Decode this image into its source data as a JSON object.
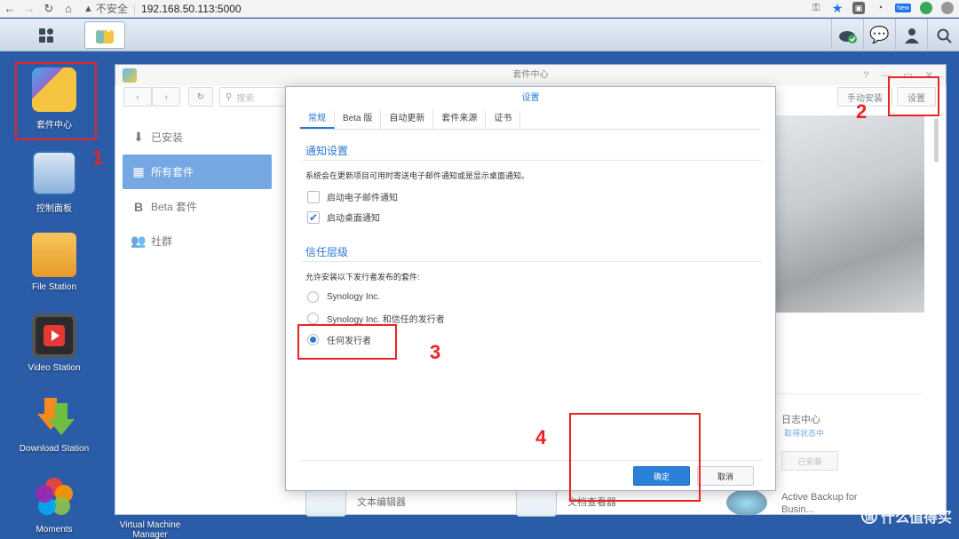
{
  "browser": {
    "security_label": "不安全",
    "url": "192.168.50.113:5000",
    "new_badge": "New"
  },
  "desktop": {
    "icons": [
      {
        "label": "套件中心"
      },
      {
        "label": "控制面板"
      },
      {
        "label": "File Station"
      },
      {
        "label": "Video Station"
      },
      {
        "label": "Download Station"
      },
      {
        "label": "Moments"
      },
      {
        "label": "Virtual Machine Manager"
      }
    ]
  },
  "annotations": {
    "n1": "1",
    "n2": "2",
    "n3": "3",
    "n4": "4"
  },
  "window": {
    "title": "套件中心",
    "search_placeholder": "搜索",
    "manual_install": "手动安装",
    "settings": "设置",
    "sidebar": [
      {
        "label": "已安装"
      },
      {
        "label": "所有套件"
      },
      {
        "label": "Beta 套件"
      },
      {
        "label": "社群"
      }
    ],
    "card": {
      "title": "日志中心",
      "link": "取得状态中",
      "button": "已安装"
    },
    "bottom_apps": [
      {
        "label": "文本编辑器"
      },
      {
        "label": "文档查看器"
      }
    ],
    "bottom_card": {
      "title": "Active Backup for",
      "sub": "Busin..."
    }
  },
  "modal": {
    "title": "设置",
    "tabs": [
      "常规",
      "Beta 版",
      "自动更新",
      "套件来源",
      "证书"
    ],
    "notify_title": "通知设置",
    "notify_desc": "系统会在更新项目可用时寄送电子邮件通知或是显示桌面通知。",
    "opt_email": "启动电子邮件通知",
    "opt_desktop": "启动桌面通知",
    "trust_title": "信任层级",
    "trust_desc": "允许安装以下发行者发布的套件:",
    "trust_opts": [
      "Synology Inc.",
      "Synology Inc. 和信任的发行者",
      "任何发行者"
    ],
    "ok": "确定",
    "cancel": "取消"
  },
  "watermark": {
    "text": "什么值得买",
    "glyph": "值"
  }
}
